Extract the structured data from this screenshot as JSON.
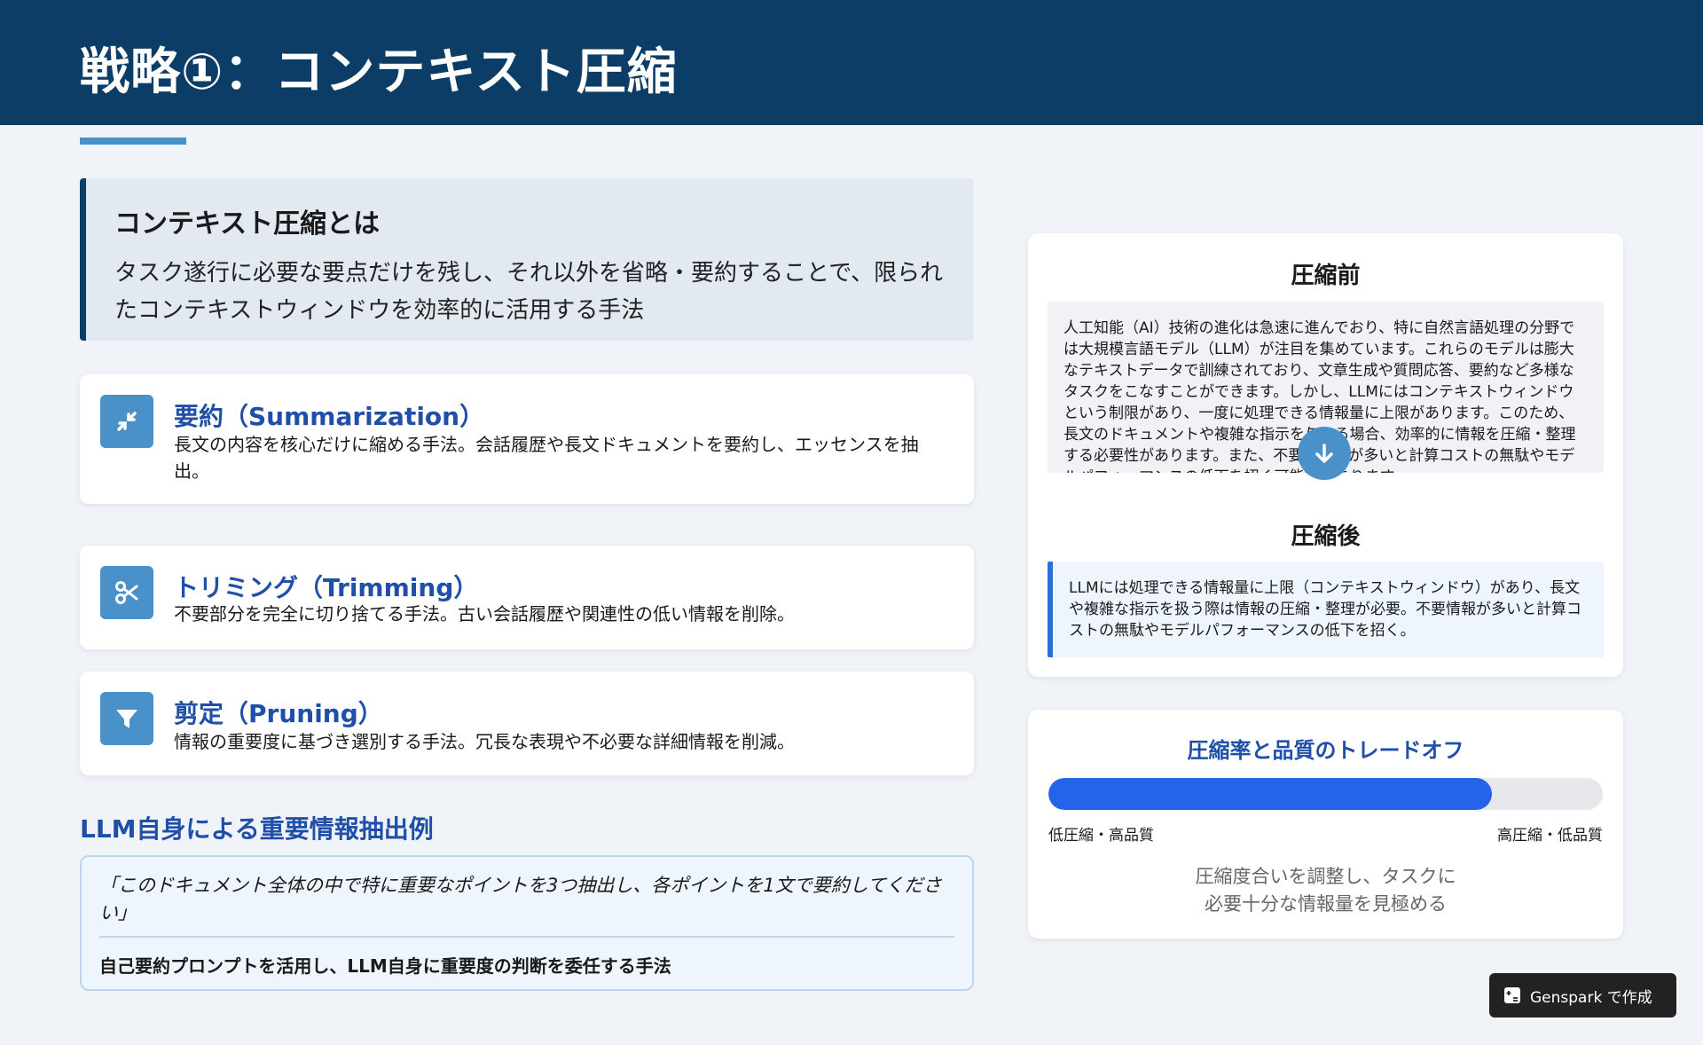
{
  "header": {
    "title": "戦略①：コンテキスト圧縮"
  },
  "definition": {
    "title": "コンテキスト圧縮とは",
    "text": "タスク遂行に必要な要点だけを残し、それ以外を省略・要約することで、限られたコンテキストウィンドウを効率的に活用する手法"
  },
  "methods": [
    {
      "icon": "compress-arrows-icon",
      "title": "要約（Summarization）",
      "desc": "長文の内容を核心だけに縮める手法。会話履歴や長文ドキュメントを要約し、エッセンスを抽出。"
    },
    {
      "icon": "scissors-icon",
      "title": "トリミング（Trimming）",
      "desc": "不要部分を完全に切り捨てる手法。古い会話履歴や関連性の低い情報を削除。"
    },
    {
      "icon": "filter-icon",
      "title": "剪定（Pruning）",
      "desc": "情報の重要度に基づき選別する手法。冗長な表現や不必要な詳細情報を削減。"
    }
  ],
  "extract": {
    "title": "LLM自身による重要情報抽出例",
    "quote": "「このドキュメント全体の中で特に重要なポイントを3つ抽出し、各ポイントを1文で要約してください」",
    "note": "自己要約プロンプトを活用し、LLM自身に重要度の判断を委任する手法"
  },
  "compare": {
    "before_title": "圧縮前",
    "before_text": "人工知能（AI）技術の進化は急速に進んでおり、特に自然言語処理の分野では大規模言語モデル（LLM）が注目を集めています。これらのモデルは膨大なテキストデータで訓練されており、文章生成や質問応答、要約など多様なタスクをこなすことができます。しかし、LLMにはコンテキストウィンドウという制限があり、一度に処理できる情報量に上限があります。このため、長文のドキュメントや複雑な指示を与える場合、効率的に情報を圧縮・整理する必要性があります。また、不要な情報が多いと計算コストの無駄やモデルパフォーマンスの低下を招く可能性があります。",
    "arrow_icon": "arrow-down-icon",
    "after_title": "圧縮後",
    "after_text": "LLMには処理できる情報量に上限（コンテキストウィンドウ）があり、長文や複雑な指示を扱う際は情報の圧縮・整理が必要。不要情報が多いと計算コストの無駄やモデルパフォーマンスの低下を招く。"
  },
  "tradeoff": {
    "title": "圧縮率と品質のトレードオフ",
    "level": 0.8,
    "left_label": "低圧縮・高品質",
    "right_label": "高圧縮・低品質",
    "caption_line1": "圧縮度合いを調整し、タスクに",
    "caption_line2": "必要十分な情報量を見極める",
    "fill_color": "#2563eb"
  },
  "badge": {
    "label": "Genspark で作成"
  }
}
